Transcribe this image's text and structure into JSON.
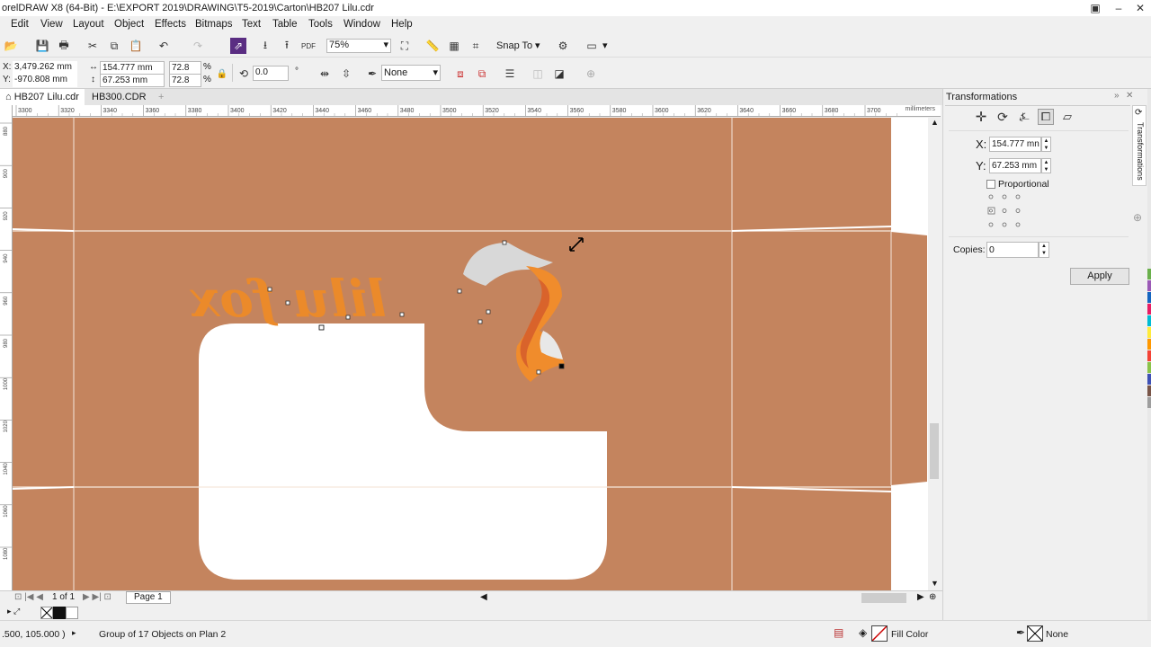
{
  "window": {
    "title": "orelDRAW X8 (64-Bit) - E:\\EXPORT 2019\\DRAWING\\T5-2019\\Carton\\HB207 Lilu.cdr"
  },
  "menu": [
    "Edit",
    "View",
    "Layout",
    "Object",
    "Effects",
    "Bitmaps",
    "Text",
    "Table",
    "Tools",
    "Window",
    "Help"
  ],
  "toolbar": {
    "zoom": "75%",
    "snap_to": "Snap To"
  },
  "propbar": {
    "x": "3,479.262 mm",
    "y": "-970.808 mm",
    "width": "154.777 mm",
    "height": "67.253 mm",
    "scale_w": "72.8",
    "scale_h": "72.8",
    "percent": "%",
    "rotation": "0.0",
    "rotation_unit": "°",
    "outline": "None",
    "x_label": "X:",
    "y_label": "Y:"
  },
  "tabs": [
    "HB207 Lilu.cdr",
    "HB300.CDR"
  ],
  "ruler": {
    "h_ticks": [
      "3300",
      "3320",
      "3340",
      "3360",
      "3380",
      "3400",
      "3420",
      "3440",
      "3460",
      "3480",
      "3500",
      "3520",
      "3540",
      "3560",
      "3580",
      "3600",
      "3620",
      "3640",
      "3660",
      "3680",
      "3700"
    ],
    "unit": "millimeters",
    "v_ticks": [
      "880",
      "900",
      "920",
      "940",
      "960",
      "980",
      "1000",
      "1020",
      "1040",
      "1060",
      "1080"
    ]
  },
  "canvas": {
    "artwork_text": "lilu fox",
    "carton_color": "#c4845e"
  },
  "pagebar": {
    "page_of": "1 of 1",
    "page_tab": "Page 1"
  },
  "status": {
    "coords": ".500, 105.000 )",
    "selection": "Group of 17 Objects on Plan 2",
    "fill_label": "Fill Color",
    "outline_label": "None"
  },
  "docker": {
    "title": "Transformations",
    "x_label": "X:",
    "x_value": "154.777 mn",
    "y_label": "Y:",
    "y_value": "67.253 mm",
    "proportional": "Proportional",
    "copies_label": "Copies:",
    "copies_value": "0",
    "apply": "Apply",
    "side_tab": "Transformations"
  },
  "palette_colors": [
    "#6ab04c",
    "#9b59b6",
    "#1565c0",
    "#e91e63",
    "#00bcd4",
    "#ffeb3b",
    "#ff9800",
    "#f44336",
    "#8bc34a",
    "#3f51b5",
    "#795548",
    "#9e9e9e"
  ]
}
